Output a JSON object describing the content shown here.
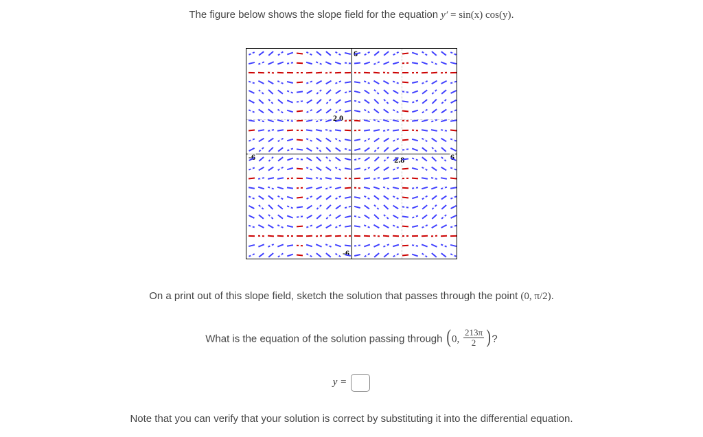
{
  "intro_text_prefix": "The figure below shows the slope field for the equation ",
  "equation_lhs": "y′",
  "equation_eq": " = ",
  "equation_rhs": "sin(x) cos(y)",
  "intro_text_suffix": ".",
  "sketch_instruction_prefix": "On a print out of this slope field, sketch the solution that passes through the point ",
  "sketch_point": "(0, π/2)",
  "sketch_instruction_suffix": ".",
  "question_prefix": "What is the equation of the solution passing through ",
  "question_point_zero": "0, ",
  "question_frac_num": "213π",
  "question_frac_den": "2",
  "question_suffix": "?",
  "answer_label": "y = ",
  "answer_value": "",
  "note_text": "Note that you can verify that your solution is correct by substituting it into the differential equation.",
  "chart_data": {
    "type": "slope_field",
    "equation": "y' = sin(x) * cos(y)",
    "xrange": [
      -6,
      6
    ],
    "yrange": [
      -6,
      6
    ],
    "xticks": [
      -6,
      2.8,
      6
    ],
    "yticks": [
      -6,
      2.0,
      6
    ],
    "grid_spacing_approx": 0.5,
    "axis_labels": {
      "top": "6",
      "bottom": "-6",
      "left": "-6",
      "right": "6",
      "y_interior": "2.0",
      "x_interior": "2.8"
    }
  }
}
